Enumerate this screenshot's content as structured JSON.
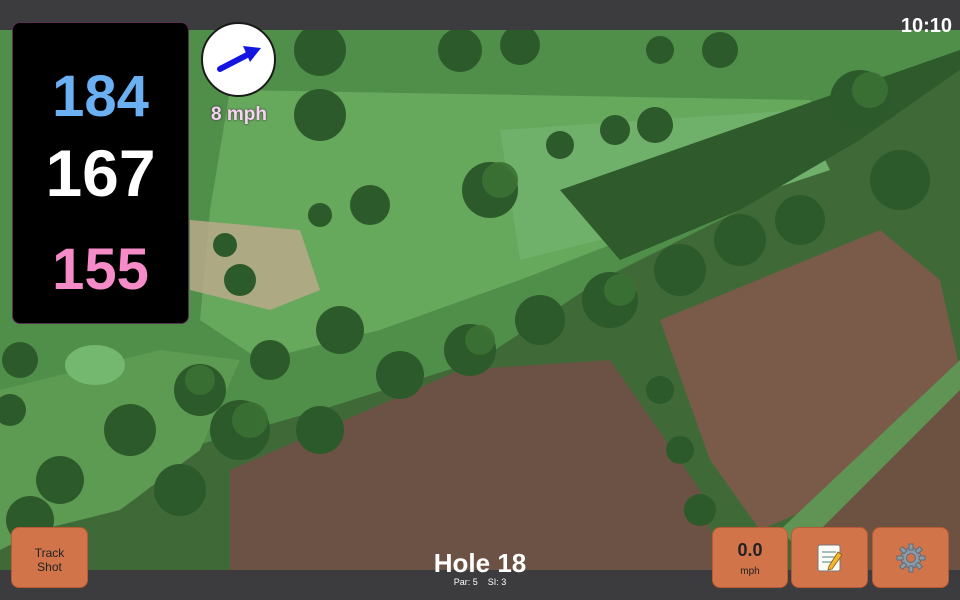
{
  "status": {
    "time": "10:10"
  },
  "yardage": {
    "back": "184",
    "middle": "167",
    "front": "155"
  },
  "wind": {
    "speed_label": "8 mph",
    "direction_icon": "arrow-icon",
    "direction": "east-north-east"
  },
  "buttons": {
    "track_shot": {
      "line1": "Track",
      "line2": "Shot"
    },
    "speed": {
      "value": "0.0",
      "unit": "mph"
    },
    "notes": {
      "icon": "notepad-icon"
    },
    "settings": {
      "icon": "gear-icon"
    }
  },
  "hole": {
    "title": "Hole 18",
    "par": "Par: 5",
    "si": "SI: 3"
  },
  "colors": {
    "back": "#6ab0f2",
    "middle": "#ffffff",
    "front": "#f58cc8",
    "button": "#d2744a",
    "wind_arrow": "#1515e0",
    "wind_text": "#f5d6f0"
  }
}
